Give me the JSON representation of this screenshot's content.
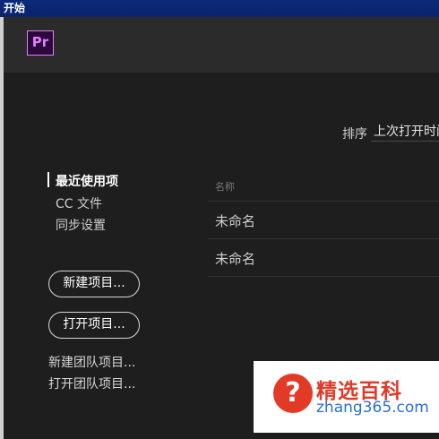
{
  "window": {
    "title": "开始"
  },
  "app": {
    "logo_text": "Pr"
  },
  "sort": {
    "label": "排序",
    "value": "上次打开时间"
  },
  "nav": {
    "items": [
      {
        "label": "最近使用项",
        "active": true
      },
      {
        "label": "CC 文件",
        "active": false
      },
      {
        "label": "同步设置",
        "active": false
      }
    ]
  },
  "actions": {
    "new_project": "新建项目...",
    "open_project": "打开项目...",
    "new_team_project": "新建团队项目...",
    "open_team_project": "打开团队项目..."
  },
  "recent": {
    "column_name": "名称",
    "rows": [
      "未命名",
      "未命名"
    ]
  },
  "watermark": {
    "icon_char": "?",
    "brand": "精选百科",
    "url": "zhang365.com",
    "colors": {
      "brand": "#e23a27",
      "url": "#2a6fd1"
    }
  },
  "colors": {
    "accent": "#e77bff",
    "background": "#1e1e1e",
    "header": "#2b2b2b"
  }
}
